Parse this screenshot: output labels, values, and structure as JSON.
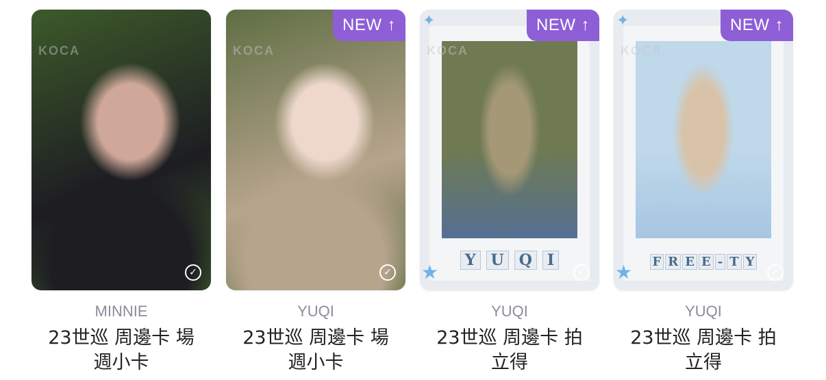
{
  "cards": [
    {
      "name": "MINNIE",
      "title": "23世巡 周邊卡 場\n週小卡",
      "badge": "",
      "frame": "photo",
      "photo_colors": [
        "#3d5a2a",
        "#1d1d22",
        "#cfa89a"
      ],
      "letters": []
    },
    {
      "name": "YUQI",
      "title": "23世巡 周邊卡 場\n週小卡",
      "badge": "NEW",
      "frame": "photo",
      "photo_colors": [
        "#5e6e43",
        "#b7a48d",
        "#eed8cc"
      ],
      "letters": []
    },
    {
      "name": "YUQI",
      "title": "23世巡 周邊卡 拍\n立得",
      "badge": "NEW",
      "frame": "polaroid",
      "photo_colors": [
        "#6f7a52",
        "#a49877",
        "#556f93"
      ],
      "letters": [
        "Y",
        "U",
        "Q",
        "I"
      ]
    },
    {
      "name": "YUQI",
      "title": "23世巡 周邊卡 拍\n立得",
      "badge": "NEW",
      "frame": "polaroid",
      "photo_colors": [
        "#bfd8ea",
        "#d9c3a8",
        "#a7c6e2"
      ],
      "letters": [
        "F",
        "R",
        "E",
        "E",
        "-",
        "T",
        "Y"
      ]
    }
  ],
  "icons": {
    "check": "check-circle-icon",
    "badge_arrow": "arrow-up-icon"
  },
  "colors": {
    "badge": "#8e5ed6",
    "name": "#8a8d99",
    "title": "#222222"
  },
  "watermark_text": "KOCA"
}
